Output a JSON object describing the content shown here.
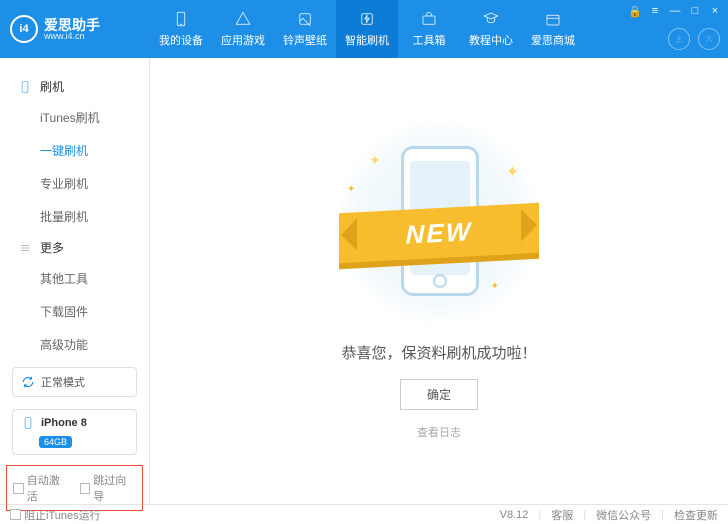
{
  "brand": {
    "name": "爱思助手",
    "url": "www.i4.cn",
    "logo": "i4"
  },
  "win": {
    "lock": "🔒",
    "menu": "≡",
    "min": "—",
    "max": "□",
    "close": "×"
  },
  "nav": [
    {
      "id": "device",
      "label": "我的设备"
    },
    {
      "id": "apps",
      "label": "应用游戏"
    },
    {
      "id": "ring",
      "label": "铃声壁纸"
    },
    {
      "id": "flash",
      "label": "智能刷机",
      "active": true
    },
    {
      "id": "toolbox",
      "label": "工具箱"
    },
    {
      "id": "tutorial",
      "label": "教程中心"
    },
    {
      "id": "mall",
      "label": "爱思商城"
    }
  ],
  "sidebar": {
    "group1": {
      "title": "刷机",
      "items": [
        {
          "id": "itunes",
          "label": "iTunes刷机"
        },
        {
          "id": "onekey",
          "label": "一键刷机",
          "active": true
        },
        {
          "id": "pro",
          "label": "专业刷机"
        },
        {
          "id": "batch",
          "label": "批量刷机"
        }
      ]
    },
    "group2": {
      "title": "更多",
      "items": [
        {
          "id": "other",
          "label": "其他工具"
        },
        {
          "id": "firmware",
          "label": "下载固件"
        },
        {
          "id": "adv",
          "label": "高级功能"
        }
      ]
    },
    "mode": "正常模式",
    "device": {
      "name": "iPhone 8",
      "storage": "64GB"
    },
    "checks": {
      "auto": "自动激活",
      "skip": "跳过向导"
    }
  },
  "main": {
    "ribbon": "NEW",
    "message": "恭喜您，保资料刷机成功啦！",
    "ok": "确定",
    "log": "查看日志"
  },
  "footer": {
    "stop_itunes": "阻止iTunes运行",
    "version": "V8.12",
    "support": "客服",
    "wechat": "微信公众号",
    "update": "检查更新"
  }
}
